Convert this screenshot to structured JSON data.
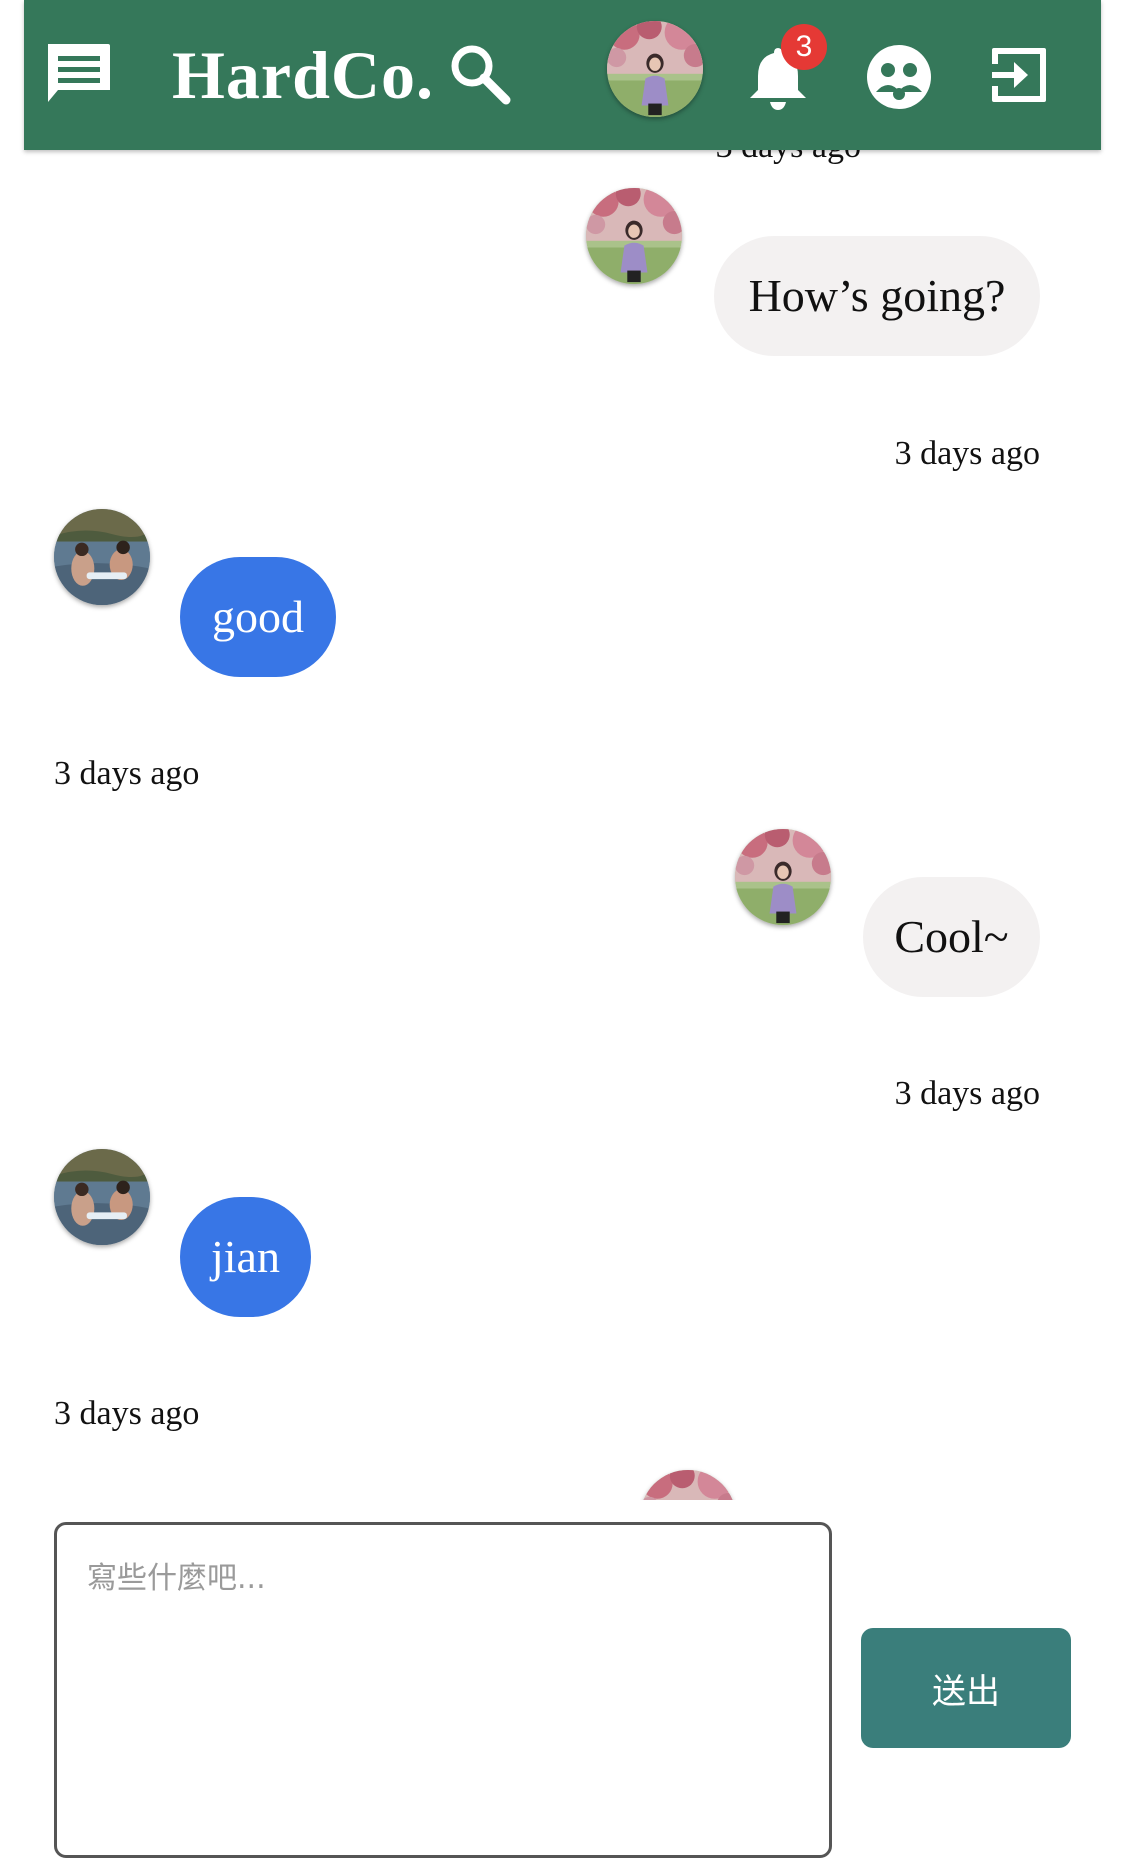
{
  "app": {
    "brand": "HardCo.",
    "notification_count": "3"
  },
  "header_icons": {
    "menu": "chat-icon",
    "search": "search-icon",
    "notifications": "bell-icon",
    "groups": "people-icon",
    "logout": "logout-icon"
  },
  "colors": {
    "header": "#35785a",
    "own_bubble": "#f3f1f1",
    "other_bubble": "#3876e6",
    "badge": "#e53935",
    "send_button": "#3a7e7b"
  },
  "messages": [
    {
      "sender": "self",
      "text": "How’s going?",
      "time": "3 days ago"
    },
    {
      "sender": "other",
      "text": "good",
      "time": "3 days ago"
    },
    {
      "sender": "self",
      "text": "Cool~",
      "time": "3 days ago"
    },
    {
      "sender": "other",
      "text": "jian",
      "time": "3 days ago"
    }
  ],
  "composer": {
    "placeholder": "寫些什麼吧...",
    "value": "",
    "send_label": "送出"
  }
}
